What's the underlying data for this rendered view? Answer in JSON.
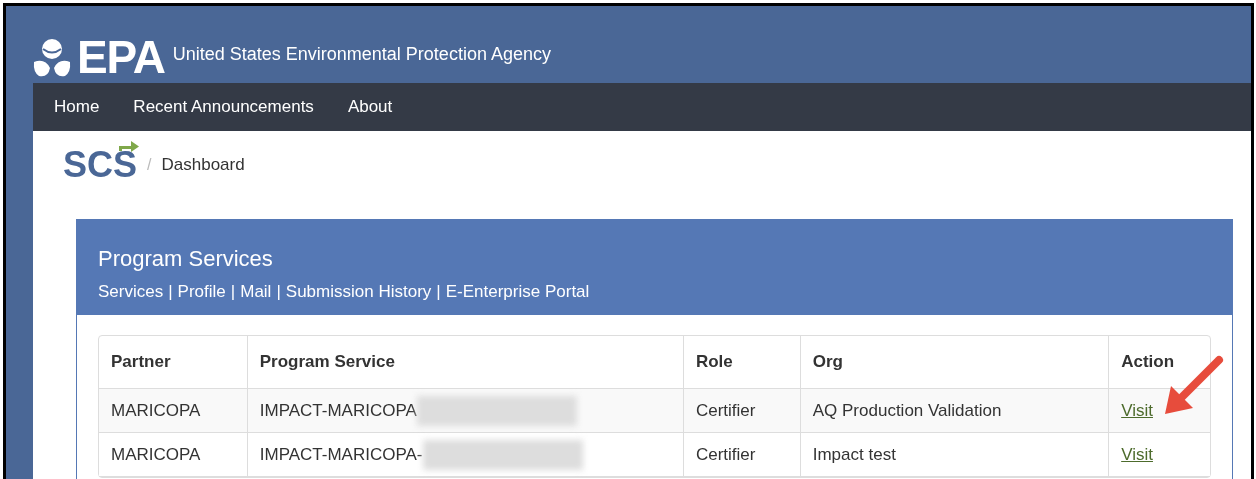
{
  "header": {
    "logo": "EPA",
    "agency": "United States Environmental Protection Agency"
  },
  "nav": [
    "Home",
    "Recent Announcements",
    "About"
  ],
  "breadcrumb": {
    "logo": "SCS",
    "separator": "/",
    "current": "Dashboard"
  },
  "panel": {
    "title": "Program Services",
    "link_separator": "|",
    "links": [
      "Services",
      "Profile",
      "Mail",
      "Submission History",
      "E-Enterprise Portal"
    ]
  },
  "table": {
    "columns": [
      "Partner",
      "Program Service",
      "Role",
      "Org",
      "Action"
    ],
    "rows": [
      {
        "partner": "MARICOPA",
        "service": "IMPACT-MARICOPA",
        "role": "Certifier",
        "org": "AQ Production Validation",
        "action": "Visit"
      },
      {
        "partner": "MARICOPA",
        "service": "IMPACT-MARICOPA-",
        "role": "Certifier",
        "org": "Impact test",
        "action": "Visit"
      }
    ]
  }
}
